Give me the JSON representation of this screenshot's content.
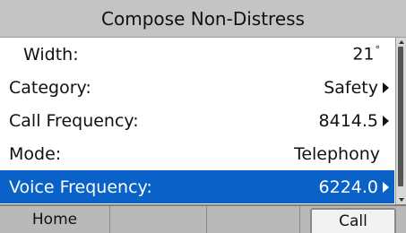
{
  "header": {
    "title": "Compose Non-Distress"
  },
  "rows": [
    {
      "label": "Width:",
      "value": "21",
      "unit": "°"
    },
    {
      "label": "Category:",
      "value": "Safety"
    },
    {
      "label": "Call Frequency:",
      "value": "8414.5"
    },
    {
      "label": "Mode:",
      "value": "Telephony"
    },
    {
      "label": "Voice Frequency:",
      "value": "6224.0"
    }
  ],
  "selected_row": "Voice Frequency:",
  "softkeys": [
    "Home",
    "",
    "",
    "Call"
  ],
  "colors": {
    "selection": "#0a62c9",
    "header": "#c4c4c4",
    "softkey_bar": "#b9b9b9"
  }
}
